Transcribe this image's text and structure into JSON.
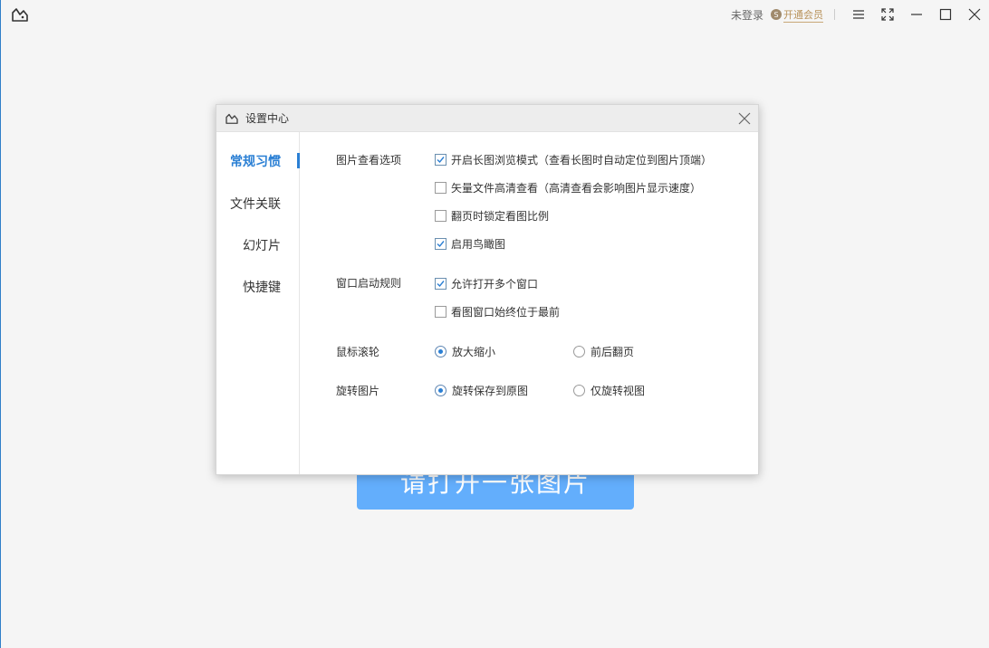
{
  "topbar": {
    "login_status": "未登录",
    "vip_label": "开通会员",
    "vip_icon_letter": "S",
    "icons": [
      "app-logo-icon",
      "menu-icon",
      "fullscreen-icon",
      "minimize-icon",
      "maximize-icon",
      "close-icon"
    ]
  },
  "main": {
    "open_button_label": "请打开一张图片"
  },
  "dialog": {
    "title": "设置中心",
    "nav": [
      {
        "label": "常规习惯",
        "active": true
      },
      {
        "label": "文件关联",
        "active": false
      },
      {
        "label": "幻灯片",
        "active": false
      },
      {
        "label": "快捷键",
        "active": false
      }
    ],
    "sections": {
      "view_options": {
        "label": "图片查看选项",
        "options": [
          {
            "label": "开启长图浏览模式（查看长图时自动定位到图片顶端）",
            "checked": true
          },
          {
            "label": "矢量文件高清查看（高清查看会影响图片显示速度）",
            "checked": false
          },
          {
            "label": "翻页时锁定看图比例",
            "checked": false
          },
          {
            "label": "启用鸟瞰图",
            "checked": true
          }
        ]
      },
      "window_rules": {
        "label": "窗口启动规则",
        "options": [
          {
            "label": "允许打开多个窗口",
            "checked": true
          },
          {
            "label": "看图窗口始终位于最前",
            "checked": false
          }
        ]
      },
      "mouse_wheel": {
        "label": "鼠标滚轮",
        "options": [
          {
            "label": "放大缩小",
            "selected": true
          },
          {
            "label": "前后翻页",
            "selected": false
          }
        ]
      },
      "rotate": {
        "label": "旋转图片",
        "options": [
          {
            "label": "旋转保存到原图",
            "selected": true
          },
          {
            "label": "仅旋转视图",
            "selected": false
          }
        ]
      }
    }
  },
  "colors": {
    "accent": "#2a7fd4",
    "open_button": "#63aefc",
    "vip_gold": "#b8925a"
  }
}
